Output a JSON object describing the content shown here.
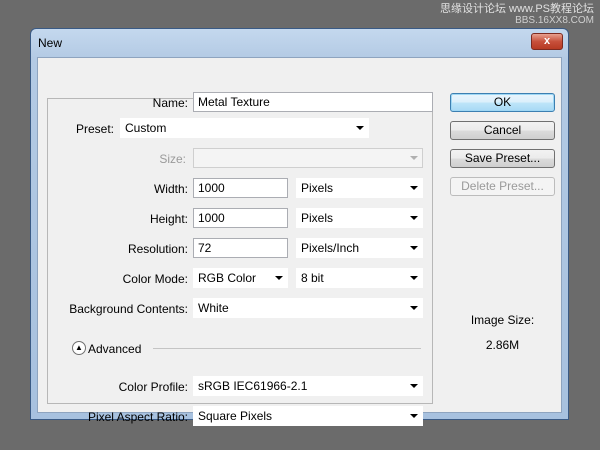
{
  "watermark": {
    "line1": "思缘设计论坛 www.PS教程论坛",
    "line2": "BBS.16XX8.COM"
  },
  "window": {
    "title": "New",
    "close_glyph": "x"
  },
  "fields": {
    "name": {
      "label": "Name:",
      "value": "Metal Texture"
    },
    "preset": {
      "label": "Preset:",
      "value": "Custom"
    },
    "size": {
      "label": "Size:",
      "value": ""
    },
    "width": {
      "label": "Width:",
      "value": "1000",
      "unit": "Pixels"
    },
    "height": {
      "label": "Height:",
      "value": "1000",
      "unit": "Pixels"
    },
    "resolution": {
      "label": "Resolution:",
      "value": "72",
      "unit": "Pixels/Inch"
    },
    "color_mode": {
      "label": "Color Mode:",
      "value": "RGB Color",
      "depth": "8 bit"
    },
    "background": {
      "label": "Background Contents:",
      "value": "White"
    },
    "advanced": {
      "label": "Advanced",
      "icon": "collapse-chevrons-icon"
    },
    "color_profile": {
      "label": "Color Profile:",
      "value": "sRGB IEC61966-2.1"
    },
    "pixel_aspect": {
      "label": "Pixel Aspect Ratio:",
      "value": "Square Pixels"
    }
  },
  "buttons": {
    "ok": "OK",
    "cancel": "Cancel",
    "save_preset": "Save Preset...",
    "delete_preset": "Delete Preset..."
  },
  "image_size": {
    "label": "Image Size:",
    "value": "2.86M"
  }
}
